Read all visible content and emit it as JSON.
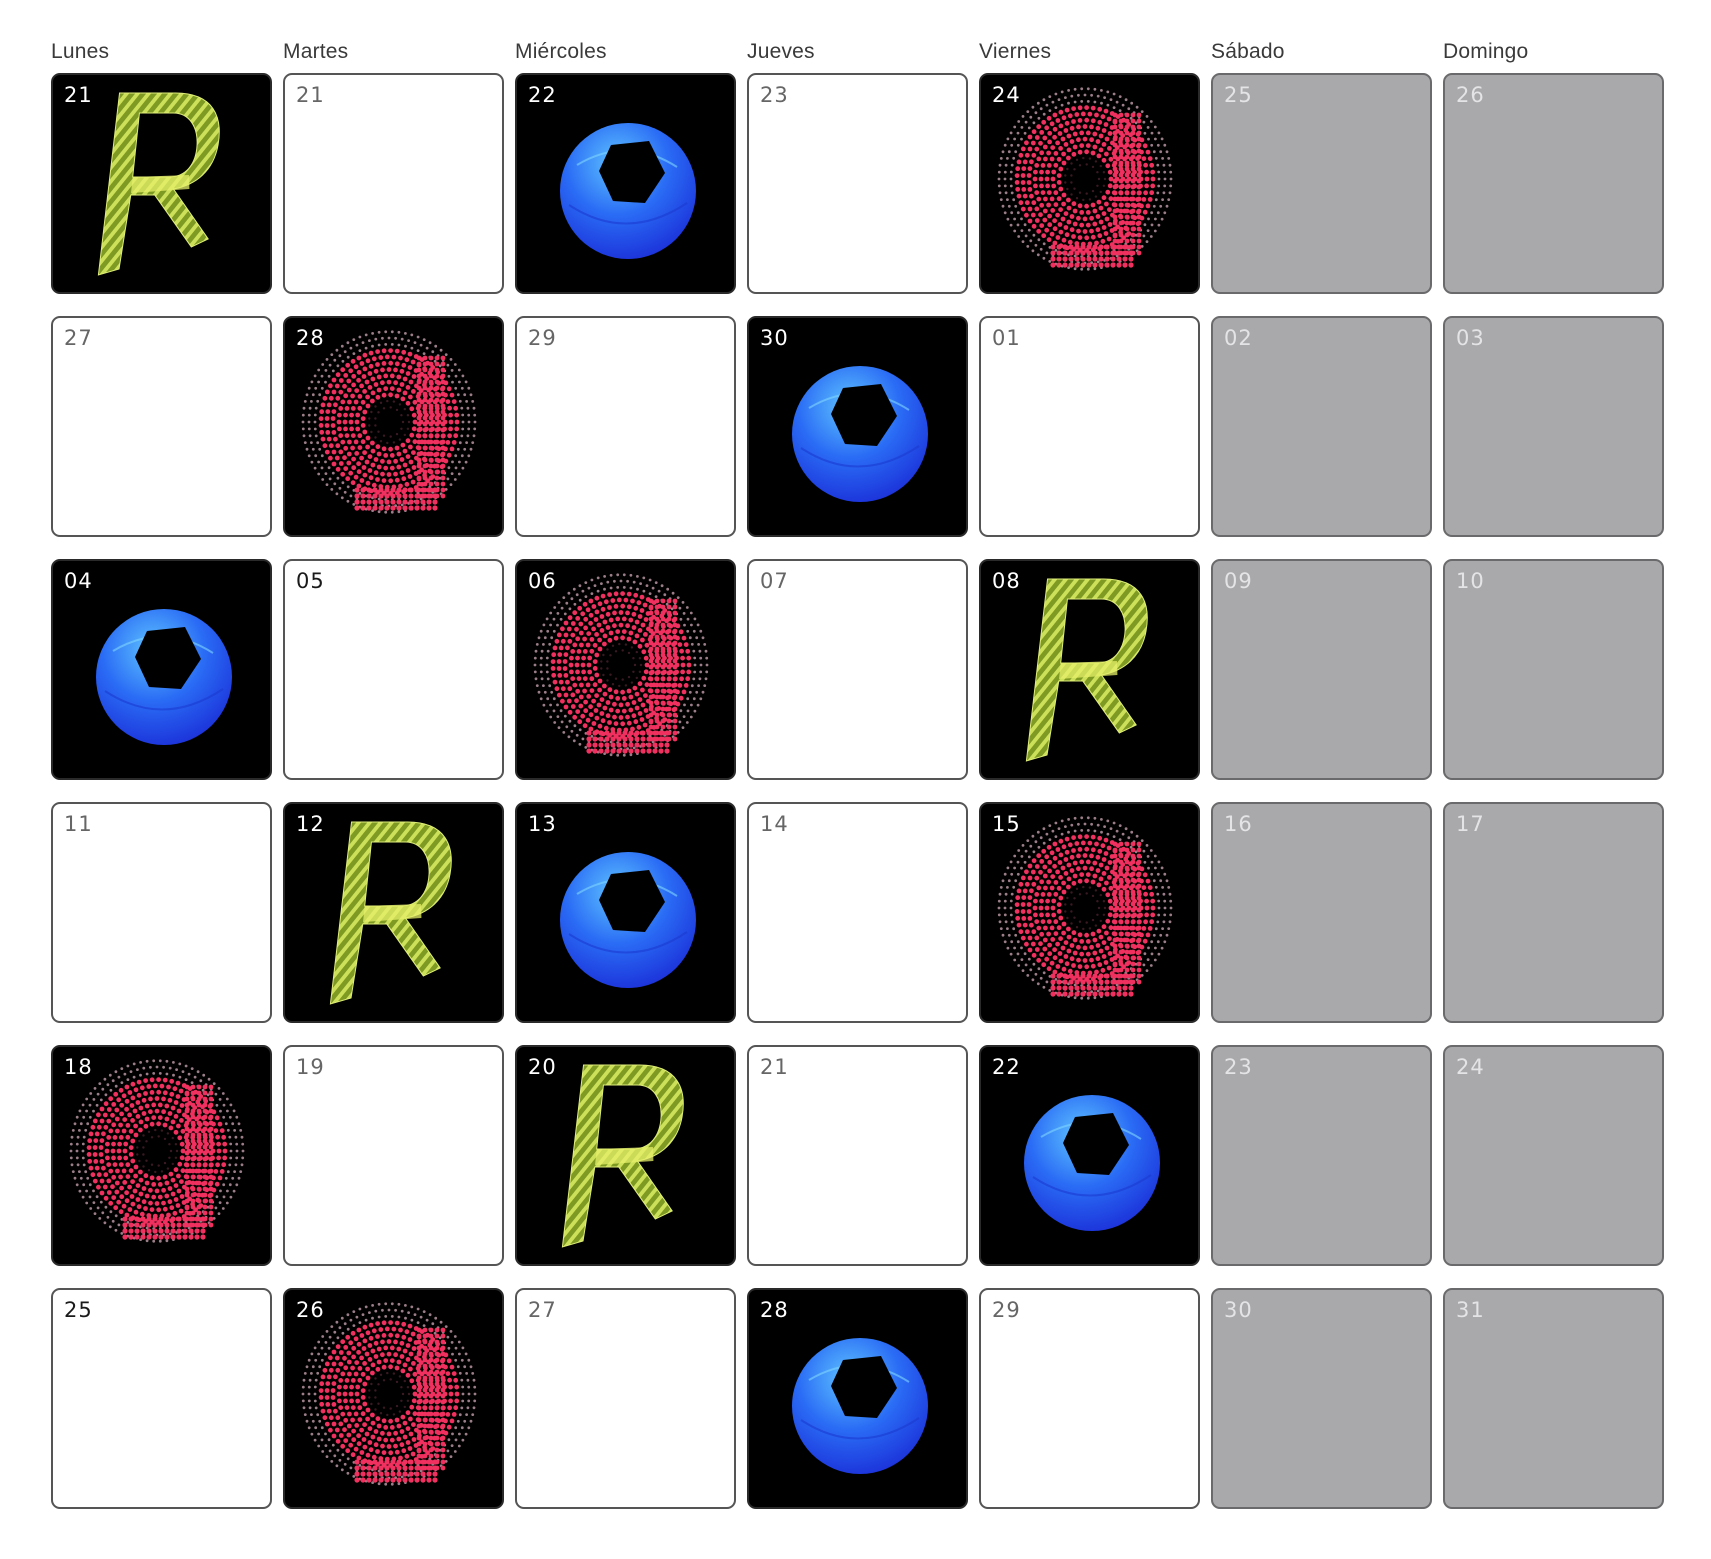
{
  "weekdays": [
    "Lunes",
    "Martes",
    "Miércoles",
    "Jueves",
    "Viernes",
    "Sábado",
    "Domingo"
  ],
  "weeks": [
    [
      {
        "label": "21",
        "kind": "art",
        "art": "letter-r-icon"
      },
      {
        "label": "21",
        "kind": "empty"
      },
      {
        "label": "22",
        "kind": "art",
        "art": "letter-o-icon"
      },
      {
        "label": "23",
        "kind": "empty"
      },
      {
        "label": "24",
        "kind": "art",
        "art": "letter-g-icon"
      },
      {
        "label": "25",
        "kind": "weekend"
      },
      {
        "label": "26",
        "kind": "weekend"
      }
    ],
    [
      {
        "label": "27",
        "kind": "empty"
      },
      {
        "label": "28",
        "kind": "art",
        "art": "letter-g-icon"
      },
      {
        "label": "29",
        "kind": "empty"
      },
      {
        "label": "30",
        "kind": "art",
        "art": "letter-o-icon"
      },
      {
        "label": "01",
        "kind": "empty"
      },
      {
        "label": "02",
        "kind": "weekend"
      },
      {
        "label": "03",
        "kind": "weekend"
      }
    ],
    [
      {
        "label": "04",
        "kind": "art",
        "art": "letter-o-icon"
      },
      {
        "label": "05",
        "kind": "empty",
        "emphasis": true
      },
      {
        "label": "06",
        "kind": "art",
        "art": "letter-g-icon"
      },
      {
        "label": "07",
        "kind": "empty"
      },
      {
        "label": "08",
        "kind": "art",
        "art": "letter-r-icon"
      },
      {
        "label": "09",
        "kind": "weekend"
      },
      {
        "label": "10",
        "kind": "weekend"
      }
    ],
    [
      {
        "label": "11",
        "kind": "empty"
      },
      {
        "label": "12",
        "kind": "art",
        "art": "letter-r-icon"
      },
      {
        "label": "13",
        "kind": "art",
        "art": "letter-o-icon"
      },
      {
        "label": "14",
        "kind": "empty"
      },
      {
        "label": "15",
        "kind": "art",
        "art": "letter-g-icon"
      },
      {
        "label": "16",
        "kind": "weekend"
      },
      {
        "label": "17",
        "kind": "weekend"
      }
    ],
    [
      {
        "label": "18",
        "kind": "art",
        "art": "letter-g-icon"
      },
      {
        "label": "19",
        "kind": "empty"
      },
      {
        "label": "20",
        "kind": "art",
        "art": "letter-r-icon"
      },
      {
        "label": "21",
        "kind": "empty"
      },
      {
        "label": "22",
        "kind": "art",
        "art": "letter-o-icon"
      },
      {
        "label": "23",
        "kind": "weekend"
      },
      {
        "label": "24",
        "kind": "weekend"
      }
    ],
    [
      {
        "label": "25",
        "kind": "empty",
        "emphasis": true
      },
      {
        "label": "26",
        "kind": "art",
        "art": "letter-g-icon"
      },
      {
        "label": "27",
        "kind": "empty"
      },
      {
        "label": "28",
        "kind": "art",
        "art": "letter-o-icon"
      },
      {
        "label": "29",
        "kind": "empty"
      },
      {
        "label": "30",
        "kind": "weekend"
      },
      {
        "label": "31",
        "kind": "weekend"
      }
    ]
  ],
  "colors": {
    "art_background": "#000000",
    "weekend_fill": "#a9a9ab",
    "letter_r": "#a4c436",
    "letter_o": "#2f6cf2",
    "letter_g": "#f0305e"
  }
}
